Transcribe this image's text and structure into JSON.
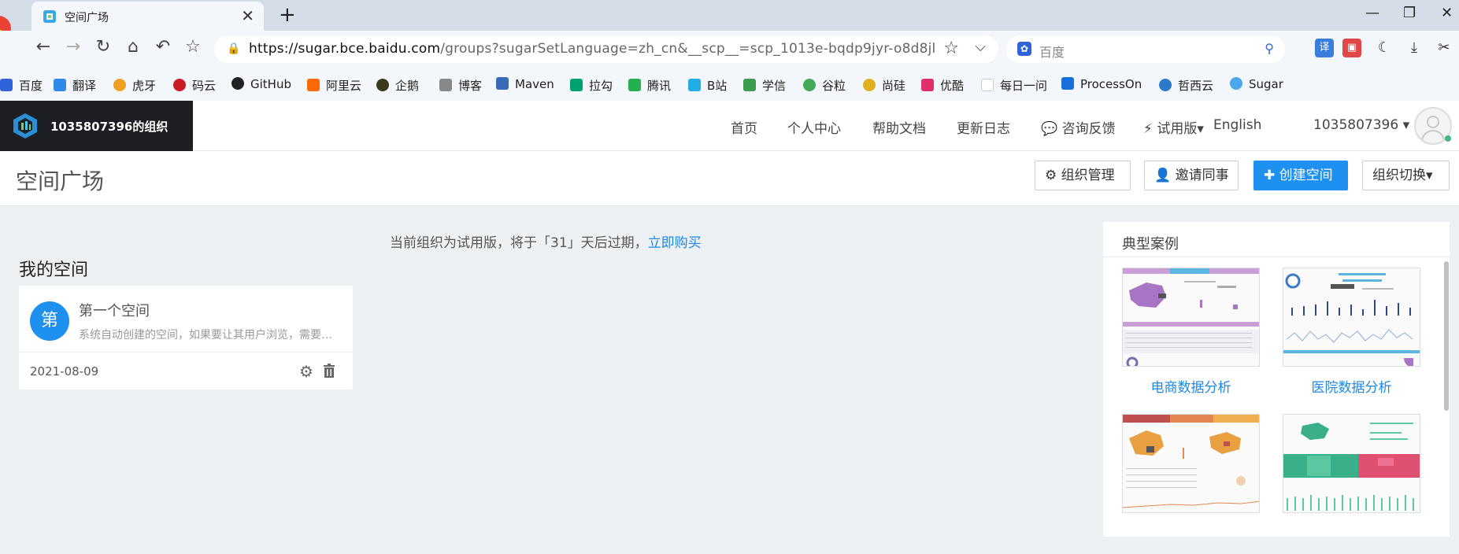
{
  "browser": {
    "tab_title": "空间广场",
    "new_tab": "+",
    "tab_close": "✕",
    "url_host": "https://sugar.bce.baidu.com",
    "url_path": "/groups?sugarSetLanguage=zh_cn&__scp__=scp_1013e-bqdp9jyr-o8d8jl",
    "search_placeholder": "百度",
    "window_minimize": "—",
    "window_restore": "❐",
    "window_close": "✕",
    "extensions": [
      {
        "label": "译",
        "color": "#3b7ddd",
        "icon": "translate-icon"
      },
      {
        "label": "▣",
        "color": "#e04848",
        "icon": "pdf-icon"
      },
      {
        "label": "☾",
        "color": "#f3f6fa",
        "icon": "dark-mode-icon"
      },
      {
        "label": "⤓",
        "color": "#f3f6fa",
        "icon": "download-icon"
      },
      {
        "label": "✂",
        "color": "#f3f6fa",
        "icon": "scissors-icon"
      }
    ]
  },
  "bookmarks": [
    {
      "label": "百度",
      "color": "#2e63d9"
    },
    {
      "label": "翻译",
      "color": "#2e8ae6"
    },
    {
      "label": "虎牙",
      "color": "#f0a020"
    },
    {
      "label": "码云",
      "color": "#c71d23"
    },
    {
      "label": "GitHub",
      "color": "#222222"
    },
    {
      "label": "阿里云",
      "color": "#ff6a00"
    },
    {
      "label": "企鹅",
      "color": "#3a3a1a"
    },
    {
      "label": "博客",
      "color": "#888888"
    },
    {
      "label": "Maven",
      "color": "#3b6ab8"
    },
    {
      "label": "拉勾",
      "color": "#00a170"
    },
    {
      "label": "腾讯",
      "color": "#22b14c"
    },
    {
      "label": "B站",
      "color": "#23ade5"
    },
    {
      "label": "学信",
      "color": "#3a9c4c"
    },
    {
      "label": "谷粒",
      "color": "#44aa55"
    },
    {
      "label": "尚硅",
      "color": "#e0b020"
    },
    {
      "label": "优酷",
      "color": "#e0306a"
    },
    {
      "label": "每日一问",
      "color": "#eeeeee"
    },
    {
      "label": "ProcessOn",
      "color": "#1870d8"
    },
    {
      "label": "哲西云",
      "color": "#2a7ac8"
    },
    {
      "label": "Sugar",
      "color": "#4aa8e8"
    }
  ],
  "app": {
    "org_name": "1035807396的组织",
    "nav": [
      {
        "label": "首页"
      },
      {
        "label": "个人中心"
      },
      {
        "label": "帮助文档"
      },
      {
        "label": "更新日志"
      },
      {
        "label": "💬 咨询反馈"
      },
      {
        "label": "⚡ 试用版▾"
      },
      {
        "label": "English"
      },
      {
        "label": "1035807396 ▾"
      }
    ],
    "colors": {
      "primary": "#1e90f0",
      "link": "#1e88e5",
      "org_bg": "#1e1f24"
    }
  },
  "page": {
    "title": "空间广场",
    "buttons": {
      "org_manage": "⚙ 组织管理",
      "invite": "👤 邀请同事",
      "create_space": "✚ 创建空间",
      "switch_org": "组织切换▾"
    }
  },
  "main": {
    "notice_text": "当前组织为试用版，将于「31」天后过期，",
    "notice_link": "立即购买",
    "my_spaces_title": "我的空间",
    "spaces": [
      {
        "avatar_char": "第",
        "name": "第一个空间",
        "desc": "系统自动创建的空间，如果要让其用户浏览，需要添加成员",
        "date": "2021-08-09"
      }
    ]
  },
  "cases": {
    "title": "典型案例",
    "items": [
      {
        "label": "电商数据分析"
      },
      {
        "label": "医院数据分析"
      },
      {
        "label": ""
      },
      {
        "label": ""
      }
    ]
  }
}
